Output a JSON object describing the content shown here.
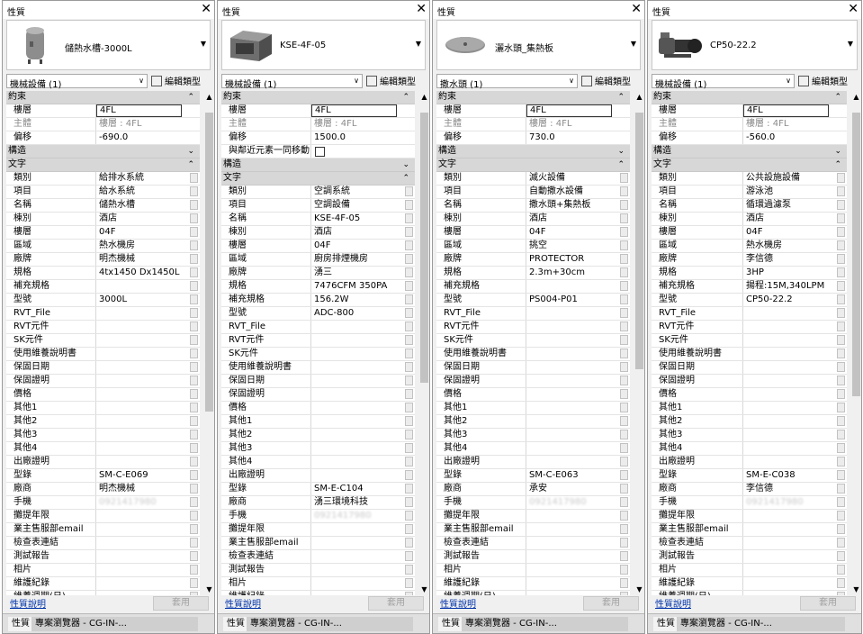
{
  "panels": [
    {
      "title": "性質",
      "close": "✕",
      "type_name": "儲熱水槽-3000L",
      "thumb_icon": "tank-icon",
      "category": "機械設備 (1)",
      "edit_type": "編輯類型",
      "help": "性質說明",
      "apply": "套用",
      "tabs": [
        "性質",
        "專案瀏覽器 - CG-IN-..."
      ],
      "rows": [
        {
          "kind": "section",
          "k": "約束",
          "chev": "⌃"
        },
        {
          "k": "樓層",
          "v": "4FL",
          "boxed": true
        },
        {
          "k": "主體",
          "v": "樓層 : 4FL",
          "gray": true
        },
        {
          "k": "偏移",
          "v": "-690.0"
        },
        {
          "kind": "section",
          "k": "構造",
          "chev": "⌄"
        },
        {
          "kind": "section",
          "k": "文字",
          "chev": "⌃"
        },
        {
          "k": "類別",
          "v": "給排水系統",
          "btn": true
        },
        {
          "k": "項目",
          "v": "給水系統",
          "btn": true
        },
        {
          "k": "名稱",
          "v": "儲熱水槽",
          "btn": true
        },
        {
          "k": "棟別",
          "v": "酒店",
          "btn": true
        },
        {
          "k": "樓層",
          "v": "04F",
          "btn": true
        },
        {
          "k": "區域",
          "v": "熱水機房",
          "btn": true
        },
        {
          "k": "廠牌",
          "v": "明杰機械",
          "btn": true
        },
        {
          "k": "規格",
          "v": "4tx1450 Dx1450L",
          "btn": true
        },
        {
          "k": "補充規格",
          "v": "",
          "btn": true
        },
        {
          "k": "型號",
          "v": "3000L",
          "btn": true
        },
        {
          "k": "RVT_File",
          "v": "",
          "btn": true
        },
        {
          "k": "RVT元件",
          "v": "",
          "btn": true
        },
        {
          "k": "SK元件",
          "v": "",
          "btn": true
        },
        {
          "k": "使用維養說明書",
          "v": "",
          "btn": true
        },
        {
          "k": "保固日期",
          "v": "",
          "btn": true
        },
        {
          "k": "保固證明",
          "v": "",
          "btn": true
        },
        {
          "k": "價格",
          "v": "",
          "btn": true
        },
        {
          "k": "其他1",
          "v": "",
          "btn": true
        },
        {
          "k": "其他2",
          "v": "",
          "btn": true
        },
        {
          "k": "其他3",
          "v": "",
          "btn": true
        },
        {
          "k": "其他4",
          "v": "",
          "btn": true
        },
        {
          "k": "出廠證明",
          "v": "",
          "btn": true
        },
        {
          "k": "型錄",
          "v": "SM-C-E069",
          "btn": true
        },
        {
          "k": "廠商",
          "v": "明杰機械",
          "btn": true
        },
        {
          "k": "手機",
          "v": "0921417980",
          "blur": true,
          "btn": true
        },
        {
          "k": "攤提年限",
          "v": "",
          "btn": true
        },
        {
          "k": "業主售服部email",
          "v": "",
          "btn": true
        },
        {
          "k": "檢查表連結",
          "v": "",
          "btn": true
        },
        {
          "k": "測試報告",
          "v": "",
          "btn": true
        },
        {
          "k": "相片",
          "v": "",
          "btn": true
        },
        {
          "k": "維護紀錄",
          "v": "",
          "btn": true
        },
        {
          "k": "維養週期(日)",
          "v": "",
          "btn": true
        }
      ]
    },
    {
      "title": "性質",
      "close": "✕",
      "type_name": "KSE-4F-05",
      "thumb_icon": "air-handler-icon",
      "category": "機械設備 (1)",
      "edit_type": "編輯類型",
      "help": "性質說明",
      "apply": "套用",
      "tabs": [
        "性質",
        "專案瀏覽器 - CG-IN-..."
      ],
      "rows": [
        {
          "kind": "section",
          "k": "約束",
          "chev": "⌃"
        },
        {
          "k": "樓層",
          "v": "4FL",
          "boxed": true
        },
        {
          "k": "主體",
          "v": "樓層 : 4FL",
          "gray": true
        },
        {
          "k": "偏移",
          "v": "1500.0"
        },
        {
          "k": "與鄰近元素一同移動",
          "v": "",
          "check": true
        },
        {
          "kind": "section",
          "k": "構造",
          "chev": "⌄"
        },
        {
          "kind": "section",
          "k": "文字",
          "chev": "⌃"
        },
        {
          "k": "類別",
          "v": "空調系統",
          "btn": true
        },
        {
          "k": "項目",
          "v": "空調設備",
          "btn": true
        },
        {
          "k": "名稱",
          "v": "KSE-4F-05",
          "btn": true
        },
        {
          "k": "棟別",
          "v": "酒店",
          "btn": true
        },
        {
          "k": "樓層",
          "v": "04F",
          "btn": true
        },
        {
          "k": "區域",
          "v": "廚房排煙機房",
          "btn": true
        },
        {
          "k": "廠牌",
          "v": "湧三",
          "btn": true
        },
        {
          "k": "規格",
          "v": "7476CFM 350PA",
          "btn": true
        },
        {
          "k": "補充規格",
          "v": "156.2W",
          "btn": true
        },
        {
          "k": "型號",
          "v": "ADC-800",
          "btn": true
        },
        {
          "k": "RVT_File",
          "v": "",
          "btn": true
        },
        {
          "k": "RVT元件",
          "v": "",
          "btn": true
        },
        {
          "k": "SK元件",
          "v": "",
          "btn": true
        },
        {
          "k": "使用維養說明書",
          "v": "",
          "btn": true
        },
        {
          "k": "保固日期",
          "v": "",
          "btn": true
        },
        {
          "k": "保固證明",
          "v": "",
          "btn": true
        },
        {
          "k": "價格",
          "v": "",
          "btn": true
        },
        {
          "k": "其他1",
          "v": "",
          "btn": true
        },
        {
          "k": "其他2",
          "v": "",
          "btn": true
        },
        {
          "k": "其他3",
          "v": "",
          "btn": true
        },
        {
          "k": "其他4",
          "v": "",
          "btn": true
        },
        {
          "k": "出廠證明",
          "v": "",
          "btn": true
        },
        {
          "k": "型錄",
          "v": "SM-E-C104",
          "btn": true
        },
        {
          "k": "廠商",
          "v": "湧三環境科技",
          "btn": true
        },
        {
          "k": "手機",
          "v": "0921417980",
          "blur": true,
          "btn": true
        },
        {
          "k": "攤提年限",
          "v": "",
          "btn": true
        },
        {
          "k": "業主售服部email",
          "v": "",
          "btn": true
        },
        {
          "k": "檢查表連結",
          "v": "",
          "btn": true
        },
        {
          "k": "測試報告",
          "v": "",
          "btn": true
        },
        {
          "k": "相片",
          "v": "",
          "btn": true
        },
        {
          "k": "維護紀錄",
          "v": "",
          "btn": true
        }
      ]
    },
    {
      "title": "性質",
      "close": "✕",
      "type_name": "灑水頭_集熱板",
      "thumb_icon": "sprinkler-icon",
      "category": "撒水頭 (1)",
      "edit_type": "編輯類型",
      "help": "性質說明",
      "apply": "套用",
      "tabs": [
        "性質",
        "專案瀏覽器 - CG-IN-..."
      ],
      "rows": [
        {
          "kind": "section",
          "k": "約束",
          "chev": "⌃"
        },
        {
          "k": "樓層",
          "v": "4FL",
          "boxed": true
        },
        {
          "k": "主體",
          "v": "樓層 : 4FL",
          "gray": true
        },
        {
          "k": "偏移",
          "v": "730.0"
        },
        {
          "kind": "section",
          "k": "構造",
          "chev": "⌄"
        },
        {
          "kind": "section",
          "k": "文字",
          "chev": "⌃"
        },
        {
          "k": "類別",
          "v": "滅火設備",
          "btn": true
        },
        {
          "k": "項目",
          "v": "自動撒水設備",
          "btn": true
        },
        {
          "k": "名稱",
          "v": "撒水頭+集熱板",
          "btn": true
        },
        {
          "k": "棟別",
          "v": "酒店",
          "btn": true
        },
        {
          "k": "樓層",
          "v": "04F",
          "btn": true
        },
        {
          "k": "區域",
          "v": "挑空",
          "btn": true
        },
        {
          "k": "廠牌",
          "v": "PROTECTOR",
          "btn": true
        },
        {
          "k": "規格",
          "v": "2.3m+30cm",
          "btn": true
        },
        {
          "k": "補充規格",
          "v": "",
          "btn": true
        },
        {
          "k": "型號",
          "v": "PS004-P01",
          "btn": true
        },
        {
          "k": "RVT_File",
          "v": "",
          "btn": true
        },
        {
          "k": "RVT元件",
          "v": "",
          "btn": true
        },
        {
          "k": "SK元件",
          "v": "",
          "btn": true
        },
        {
          "k": "使用維養說明書",
          "v": "",
          "btn": true
        },
        {
          "k": "保固日期",
          "v": "",
          "btn": true
        },
        {
          "k": "保固證明",
          "v": "",
          "btn": true
        },
        {
          "k": "價格",
          "v": "",
          "btn": true
        },
        {
          "k": "其他1",
          "v": "",
          "btn": true
        },
        {
          "k": "其他2",
          "v": "",
          "btn": true
        },
        {
          "k": "其他3",
          "v": "",
          "btn": true
        },
        {
          "k": "其他4",
          "v": "",
          "btn": true
        },
        {
          "k": "出廠證明",
          "v": "",
          "btn": true
        },
        {
          "k": "型錄",
          "v": "SM-C-E063",
          "btn": true
        },
        {
          "k": "廠商",
          "v": "承安",
          "btn": true
        },
        {
          "k": "手機",
          "v": "0921417980",
          "blur": true,
          "btn": true
        },
        {
          "k": "攤提年限",
          "v": "",
          "btn": true
        },
        {
          "k": "業主售服部email",
          "v": "",
          "btn": true
        },
        {
          "k": "檢查表連結",
          "v": "",
          "btn": true
        },
        {
          "k": "測試報告",
          "v": "",
          "btn": true
        },
        {
          "k": "相片",
          "v": "",
          "btn": true
        },
        {
          "k": "維護紀錄",
          "v": "",
          "btn": true
        },
        {
          "k": "維養週期(日)",
          "v": "",
          "btn": true
        }
      ]
    },
    {
      "title": "性質",
      "close": "✕",
      "type_name": "CP50-22.2",
      "thumb_icon": "pump-icon",
      "category": "機械設備 (1)",
      "edit_type": "編輯類型",
      "help": "性質說明",
      "apply": "套用",
      "tabs": [
        "性質",
        "專案瀏覽器 - CG-IN-..."
      ],
      "rows": [
        {
          "kind": "section",
          "k": "約束",
          "chev": "⌃"
        },
        {
          "k": "樓層",
          "v": "4FL",
          "boxed": true
        },
        {
          "k": "主體",
          "v": "樓層 : 4FL",
          "gray": true
        },
        {
          "k": "偏移",
          "v": "-560.0"
        },
        {
          "kind": "section",
          "k": "構造",
          "chev": "⌄"
        },
        {
          "kind": "section",
          "k": "文字",
          "chev": "⌃"
        },
        {
          "k": "類別",
          "v": "公共設施設備",
          "btn": true
        },
        {
          "k": "項目",
          "v": "游泳池",
          "btn": true
        },
        {
          "k": "名稱",
          "v": "循環過濾泵",
          "btn": true
        },
        {
          "k": "棟別",
          "v": "酒店",
          "btn": true
        },
        {
          "k": "樓層",
          "v": "04F",
          "btn": true
        },
        {
          "k": "區域",
          "v": "熱水機房",
          "btn": true
        },
        {
          "k": "廠牌",
          "v": "李信德",
          "btn": true
        },
        {
          "k": "規格",
          "v": "3HP",
          "btn": true
        },
        {
          "k": "補充規格",
          "v": "揚程:15M,340LPM",
          "btn": true
        },
        {
          "k": "型號",
          "v": "CP50-22.2",
          "btn": true
        },
        {
          "k": "RVT_File",
          "v": "",
          "btn": true
        },
        {
          "k": "RVT元件",
          "v": "",
          "btn": true
        },
        {
          "k": "SK元件",
          "v": "",
          "btn": true
        },
        {
          "k": "使用維養說明書",
          "v": "",
          "btn": true
        },
        {
          "k": "保固日期",
          "v": "",
          "btn": true
        },
        {
          "k": "保固證明",
          "v": "",
          "btn": true
        },
        {
          "k": "價格",
          "v": "",
          "btn": true
        },
        {
          "k": "其他1",
          "v": "",
          "btn": true
        },
        {
          "k": "其他2",
          "v": "",
          "btn": true
        },
        {
          "k": "其他3",
          "v": "",
          "btn": true
        },
        {
          "k": "其他4",
          "v": "",
          "btn": true
        },
        {
          "k": "出廠證明",
          "v": "",
          "btn": true
        },
        {
          "k": "型錄",
          "v": "SM-E-C038",
          "btn": true
        },
        {
          "k": "廠商",
          "v": "李信德",
          "btn": true
        },
        {
          "k": "手機",
          "v": "0921417980",
          "blur": true,
          "btn": true
        },
        {
          "k": "攤提年限",
          "v": "",
          "btn": true
        },
        {
          "k": "業主售服部email",
          "v": "",
          "btn": true
        },
        {
          "k": "檢查表連結",
          "v": "",
          "btn": true
        },
        {
          "k": "測試報告",
          "v": "",
          "btn": true
        },
        {
          "k": "相片",
          "v": "",
          "btn": true
        },
        {
          "k": "維護紀錄",
          "v": "",
          "btn": true
        },
        {
          "k": "維養週期(日)",
          "v": "",
          "btn": true
        }
      ]
    }
  ]
}
